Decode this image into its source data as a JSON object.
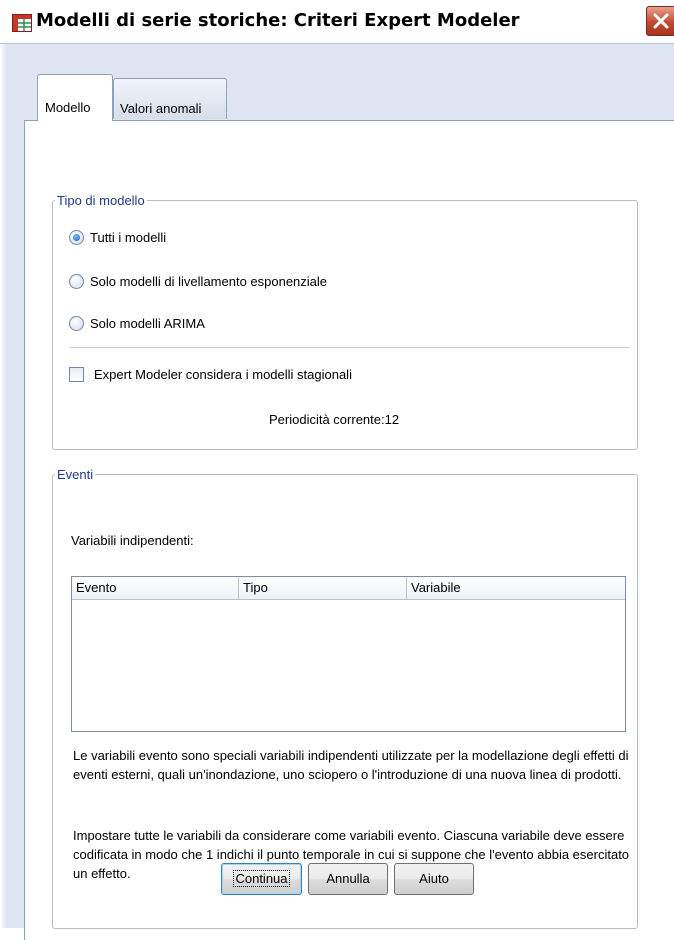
{
  "window": {
    "title": "Modelli di serie storiche: Criteri Expert Modeler",
    "icon": "spreadsheet-app-icon",
    "close_icon": "close-icon"
  },
  "tabs": [
    {
      "label": "Modello",
      "selected": true
    },
    {
      "label": "Valori anomali",
      "selected": false
    }
  ],
  "tipo_modello": {
    "legend": "Tipo di modello",
    "options": [
      {
        "label": "Tutti i modelli",
        "checked": true
      },
      {
        "label": "Solo modelli di livellamento esponenziale",
        "checked": false
      },
      {
        "label": "Solo modelli ARIMA",
        "checked": false
      }
    ],
    "seasonal_checkbox": {
      "label": "Expert Modeler considera i modelli stagionali",
      "checked": false
    },
    "periodicity": "Periodicità corrente:12"
  },
  "eventi": {
    "legend": "Eventi",
    "variables_label": "Variabili indipendenti:",
    "columns": [
      "Evento",
      "Tipo",
      "Variabile"
    ],
    "rows": [],
    "info_1": "Le variabili evento sono speciali variabili indipendenti utilizzate per la modellazione degli effetti di eventi esterni, quali un'inondazione, uno sciopero o l'introduzione di una nuova linea di prodotti.",
    "info_2": "Impostare tutte le variabili da considerare come variabili evento. Ciascuna variabile deve essere codificata in modo che 1 indichi il punto temporale in cui si suppone che l'evento abbia esercitato un effetto."
  },
  "buttons": {
    "continue": "Continua",
    "cancel": "Annulla",
    "help": "Aiuto"
  },
  "colors": {
    "accent": "#1f3b8a",
    "close_button": "#c24a33",
    "dialog_background": "#dfe6f1"
  }
}
